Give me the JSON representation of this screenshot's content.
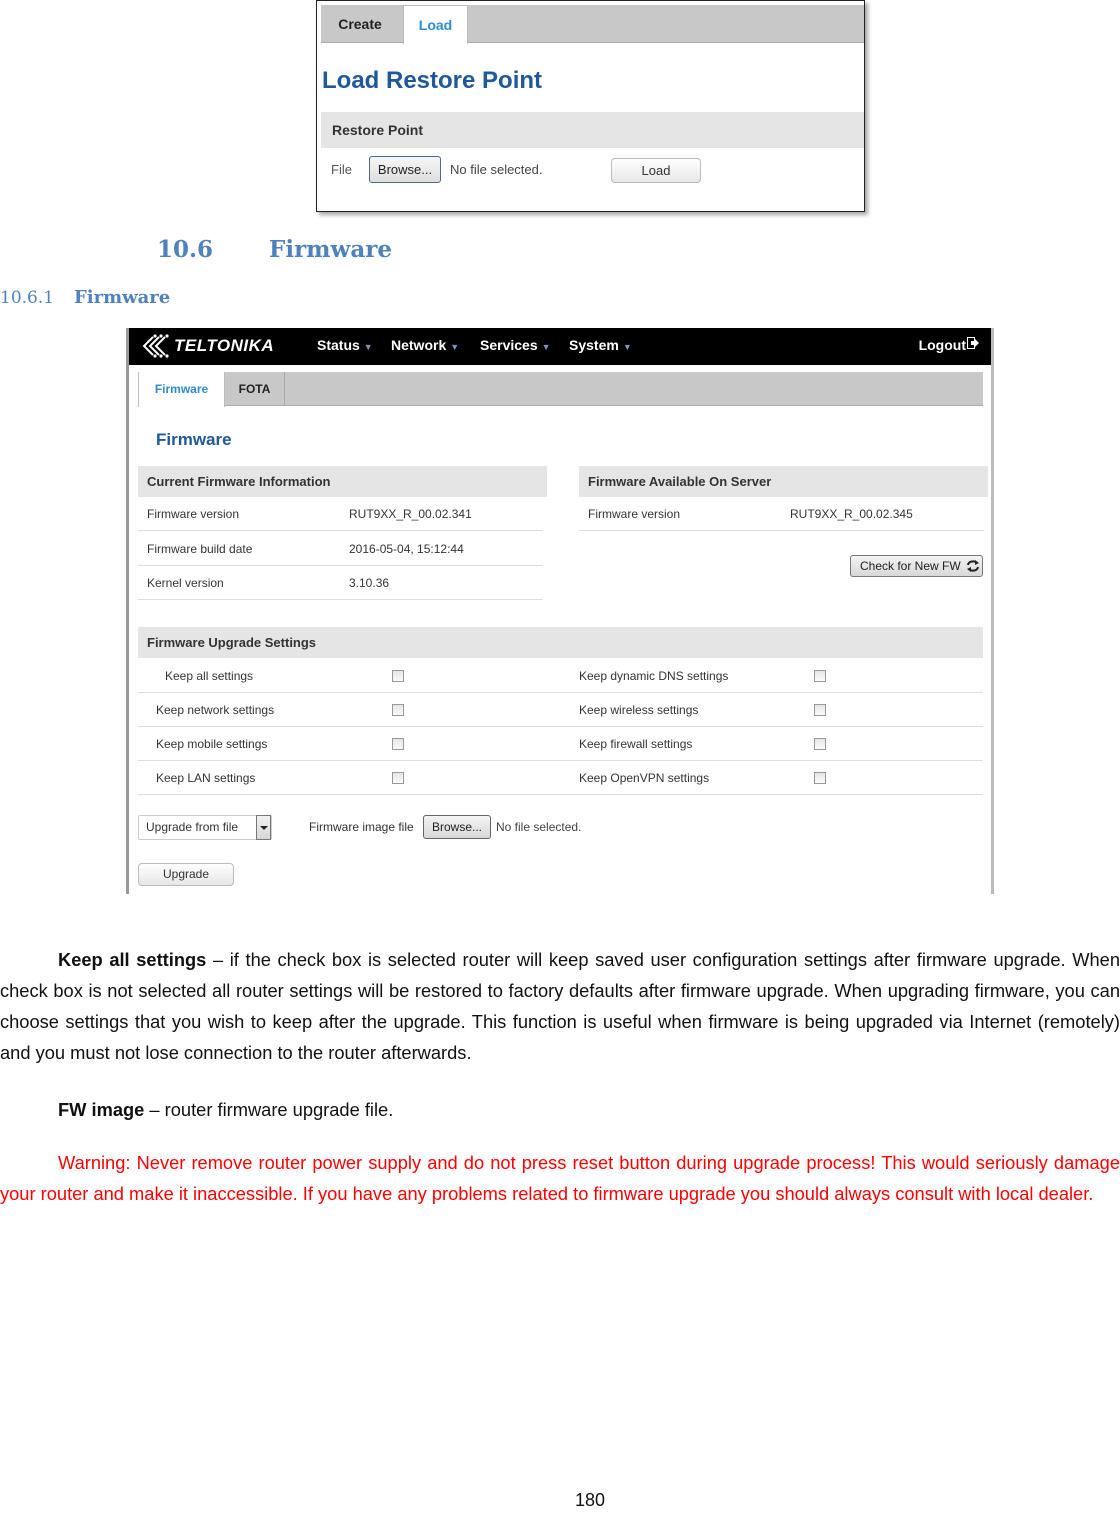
{
  "restore_screenshot": {
    "tabs": [
      {
        "label": "Create",
        "active": false
      },
      {
        "label": "Load",
        "active": true
      }
    ],
    "title": "Load Restore Point",
    "section_title": "Restore Point",
    "file_label": "File",
    "browse_label": "Browse...",
    "file_status": "No file selected.",
    "load_button": "Load"
  },
  "headings": {
    "section_number": "10.6",
    "section_title": "Firmware",
    "subsection_number": "10.6.1",
    "subsection_title": "Firmware"
  },
  "firmware_screenshot": {
    "brand": "TELTONIKA",
    "nav": {
      "menus": [
        "Status",
        "Network",
        "Services",
        "System"
      ],
      "logout": "Logout",
      "logout_icon": "logout-icon"
    },
    "tabs": [
      {
        "label": "Firmware",
        "active": true
      },
      {
        "label": "FOTA",
        "active": false
      }
    ],
    "page_title": "Firmware",
    "current_info": {
      "title": "Current Firmware Information",
      "rows": [
        {
          "label": "Firmware version",
          "value": "RUT9XX_R_00.02.341"
        },
        {
          "label": "Firmware build date",
          "value": "2016-05-04, 15:12:44"
        },
        {
          "label": "Kernel version",
          "value": "3.10.36"
        }
      ]
    },
    "server_info": {
      "title": "Firmware Available On Server",
      "rows": [
        {
          "label": "Firmware version",
          "value": "RUT9XX_R_00.02.345"
        }
      ],
      "check_button": "Check for New FW",
      "check_icon": "refresh-icon"
    },
    "upgrade_settings": {
      "title": "Firmware Upgrade Settings",
      "left": [
        {
          "label": "Keep all settings",
          "checked": false
        },
        {
          "label": "Keep network settings",
          "checked": false
        },
        {
          "label": "Keep mobile settings",
          "checked": false
        },
        {
          "label": "Keep LAN settings",
          "checked": false
        }
      ],
      "right": [
        {
          "label": "Keep dynamic DNS settings",
          "checked": false
        },
        {
          "label": "Keep wireless settings",
          "checked": false
        },
        {
          "label": "Keep firewall settings",
          "checked": false
        },
        {
          "label": "Keep OpenVPN settings",
          "checked": false
        }
      ]
    },
    "upgrade_source": "Upgrade from file",
    "image_file_label": "Firmware image file",
    "browse_label": "Browse...",
    "file_status": "No file selected.",
    "upgrade_button": "Upgrade"
  },
  "body": {
    "p1_term": "Keep all settings",
    "p1_text": " – if the check box is selected router will keep saved user configuration settings after firmware upgrade. When check box is not selected all router settings will be restored to factory defaults after firmware upgrade. When upgrading firmware, you can choose settings that you wish to keep after the upgrade. This function is useful when firmware is being upgraded via Internet (remotely) and you must not lose connection to the router afterwards.",
    "p2_term": "FW image",
    "p2_text": " – router firmware upgrade file.",
    "warning": "Warning: Never remove router power supply and do not press reset button during upgrade process! This would seriously damage your router and make it inaccessible. If you have any problems related to firmware upgrade you should always consult with local dealer.",
    "warning_color": "#ff0000",
    "heading_color": "#4f81bd"
  },
  "page_number": "180"
}
